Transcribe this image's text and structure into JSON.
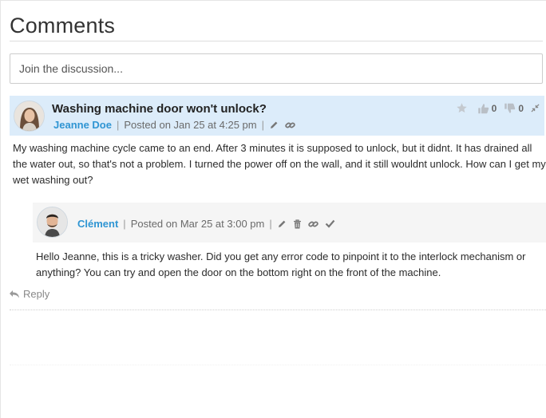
{
  "section": {
    "title": "Comments",
    "join_placeholder": "Join the discussion..."
  },
  "comment": {
    "title": "Washing machine door won't unlock?",
    "author": "Jeanne Doe",
    "posted": "Posted on Jan 25 at 4:25 pm",
    "separator": "|",
    "upvotes": "0",
    "downvotes": "0",
    "body": "My washing machine cycle came to an end. After 3 minutes it is supposed to unlock, but it didnt. It has drained all the water out, so that's not a problem. I turned the power off on the wall, and it still wouldnt unlock. How can I get my wet washing out?",
    "icons": [
      "user-avatar",
      "pencil-icon",
      "link-icon",
      "star-icon",
      "thumbs-up-icon",
      "thumbs-down-icon",
      "collapse-icon"
    ]
  },
  "reply": {
    "author": "Clément",
    "posted": "Posted on Mar 25 at 3:00 pm",
    "separator": "|",
    "body": "Hello Jeanne, this is a tricky washer. Did you get any error code to pinpoint it to the interlock mechanism or anything? You can try and open the door on the bottom right on the front of the machine.",
    "icons": [
      "user-avatar",
      "pencil-icon",
      "trash-icon",
      "link-icon",
      "check-icon"
    ]
  },
  "actions": {
    "reply_label": "Reply"
  },
  "colors": {
    "author": "#2f95d3",
    "head_bg": "#dcecfa",
    "reply_head_bg": "#f5f5f5"
  }
}
